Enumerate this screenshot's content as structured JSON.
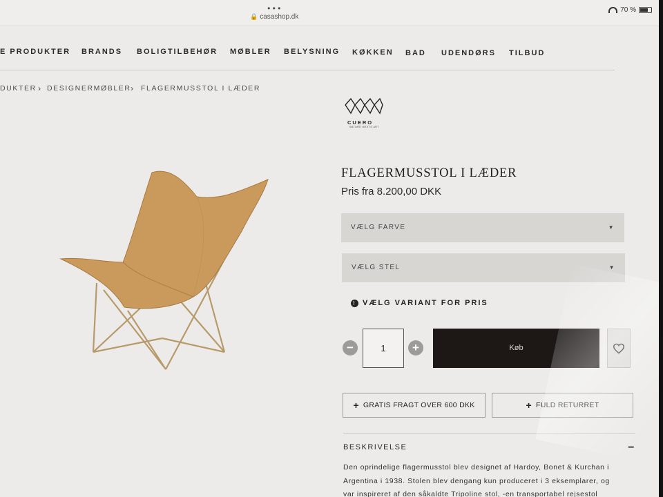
{
  "browser": {
    "url": "casashop.dk",
    "battery": "70 %"
  },
  "nav": {
    "items": [
      "E PRODUKTER",
      "BRANDS",
      "BOLIGTILBEHØR",
      "MØBLER",
      "BELYSNING",
      "KØKKEN",
      "BAD",
      "UDENDØRS",
      "TILBUD"
    ]
  },
  "breadcrumb": {
    "items": [
      "DUKTER",
      "DESIGNERMØBLER",
      "FLAGERMUSSTOL I LÆDER"
    ],
    "separator": "›"
  },
  "brand": {
    "name": "CUERO",
    "tagline": "NATURE MEETS ART"
  },
  "product": {
    "title": "FLAGERMUSSTOL I LÆDER",
    "price": "Pris fra 8.200,00 DKK",
    "color_select": "VÆLG FARVE",
    "frame_select": "VÆLG STEL",
    "variant_note": "VÆLG VARIANT FOR PRIS",
    "quantity": "1",
    "buy_label": "Køb"
  },
  "perks": {
    "shipping": "GRATIS FRAGT OVER 600 DKK",
    "returns": "FULD RETURRET"
  },
  "description": {
    "heading": "BESKRIVELSE",
    "lines": [
      "Den oprindelige flagermusstol blev designet af Hardoy, Bonet & Kurchan i",
      "Argentina i 1938. Stolen blev dengang kun produceret i 3 eksemplarer, og",
      "var inspireret af den såkaldte Tripoline stol, -en transportabel rejsestol"
    ]
  },
  "colors": {
    "buy_button": "#1d1816",
    "select_bg": "#d7d6d3",
    "leather": "#c99a5c"
  }
}
